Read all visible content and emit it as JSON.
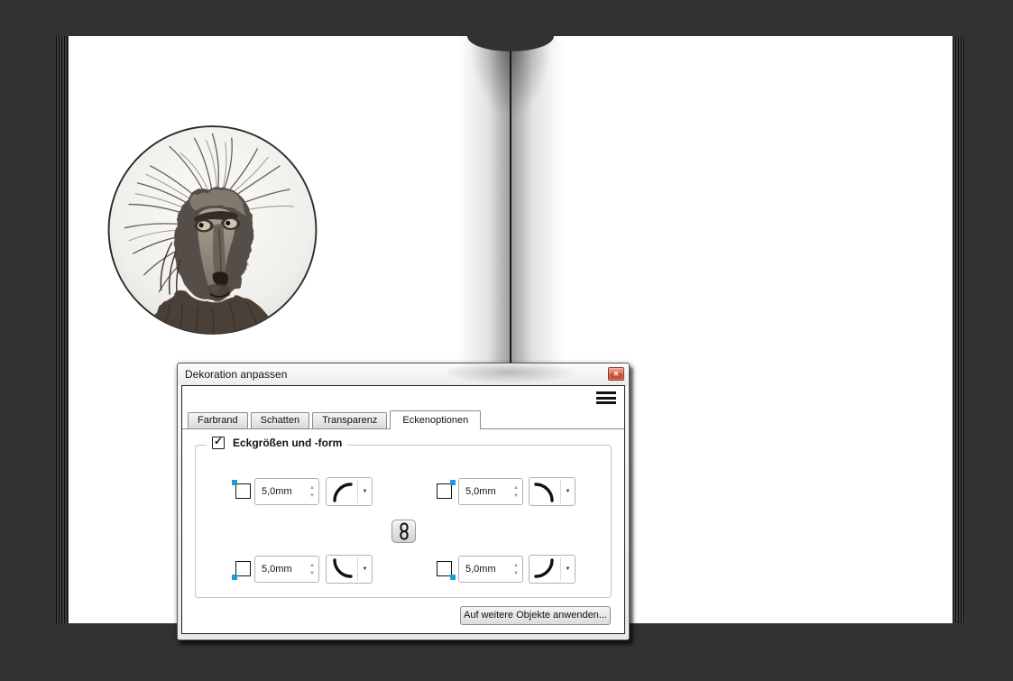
{
  "background": {
    "color": "#323232"
  },
  "book": {
    "page_color": "#ffffff",
    "photo_subject": "baboon-portrait-black-and-white"
  },
  "dialog": {
    "title": "Dekoration anpassen",
    "close_glyph": "✕",
    "menu_icon": "hamburger-menu",
    "tabs": [
      {
        "label": "Farbrand",
        "active": false
      },
      {
        "label": "Schatten",
        "active": false
      },
      {
        "label": "Transparenz",
        "active": false
      },
      {
        "label": "Eckenoptionen",
        "active": true
      }
    ],
    "group": {
      "label": "Eckgrößen und -form",
      "checkbox_checked": true,
      "check_glyph": "✓"
    },
    "corners": {
      "top_left": {
        "value": "5,0mm",
        "shape": "rounded-corner-top-left"
      },
      "top_right": {
        "value": "5,0mm",
        "shape": "rounded-corner-top-right"
      },
      "bottom_left": {
        "value": "5,0mm",
        "shape": "rounded-corner-bottom-left"
      },
      "bottom_right": {
        "value": "5,0mm",
        "shape": "rounded-corner-bottom-right"
      }
    },
    "link_button": {
      "icon": "chain-link",
      "linked": true
    },
    "apply_button_label": "Auf weitere Objekte anwenden...",
    "spinner_up_glyph": "▲",
    "spinner_down_glyph": "▼",
    "dropdown_glyph": "▼"
  },
  "colors": {
    "accent_blue": "#1e9cd8",
    "close_red": "#cd5036",
    "background": "#323232",
    "spine": "#191919"
  }
}
